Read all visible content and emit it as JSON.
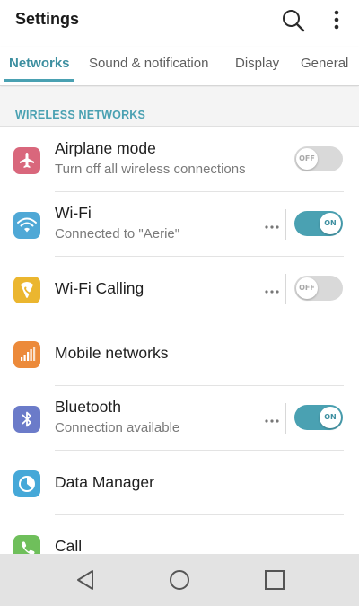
{
  "header": {
    "title": "Settings",
    "search_icon": "search-icon",
    "more_icon": "more-vert-icon"
  },
  "tabs": [
    {
      "label": "Networks",
      "active": true
    },
    {
      "label": "Sound & notification",
      "active": false
    },
    {
      "label": "Display",
      "active": false
    },
    {
      "label": "General",
      "active": false
    }
  ],
  "section": {
    "header": "WIRELESS NETWORKS"
  },
  "items": [
    {
      "title": "Airplane mode",
      "subtitle": "Turn off all wireless connections",
      "icon": "airplane-icon",
      "icon_color": "#d9677c",
      "toggle": "OFF",
      "has_more": false
    },
    {
      "title": "Wi-Fi",
      "subtitle": "Connected to \"Aerie\"",
      "icon": "wifi-icon",
      "icon_color": "#4fa8d6",
      "toggle": "ON",
      "has_more": true
    },
    {
      "title": "Wi-Fi Calling",
      "subtitle": "",
      "icon": "wifi-calling-icon",
      "icon_color": "#ebb62f",
      "toggle": "OFF",
      "has_more": true
    },
    {
      "title": "Mobile networks",
      "subtitle": "",
      "icon": "signal-icon",
      "icon_color": "#ec8a3a",
      "toggle": null,
      "has_more": false
    },
    {
      "title": "Bluetooth",
      "subtitle": "Connection available",
      "icon": "bluetooth-icon",
      "icon_color": "#6b7bc9",
      "toggle": "ON",
      "has_more": true
    },
    {
      "title": "Data Manager",
      "subtitle": "",
      "icon": "data-manager-icon",
      "icon_color": "#45a8d8",
      "toggle": null,
      "has_more": false
    },
    {
      "title": "Call",
      "subtitle": "",
      "icon": "phone-icon",
      "icon_color": "#6fbf5b",
      "toggle": null,
      "has_more": false
    }
  ],
  "colors": {
    "accent": "#4aa1b2",
    "toggle_off": "#d9d9d9"
  },
  "navbar": {
    "back_icon": "back-triangle-icon",
    "home_icon": "home-circle-icon",
    "recents_icon": "recents-square-icon"
  }
}
